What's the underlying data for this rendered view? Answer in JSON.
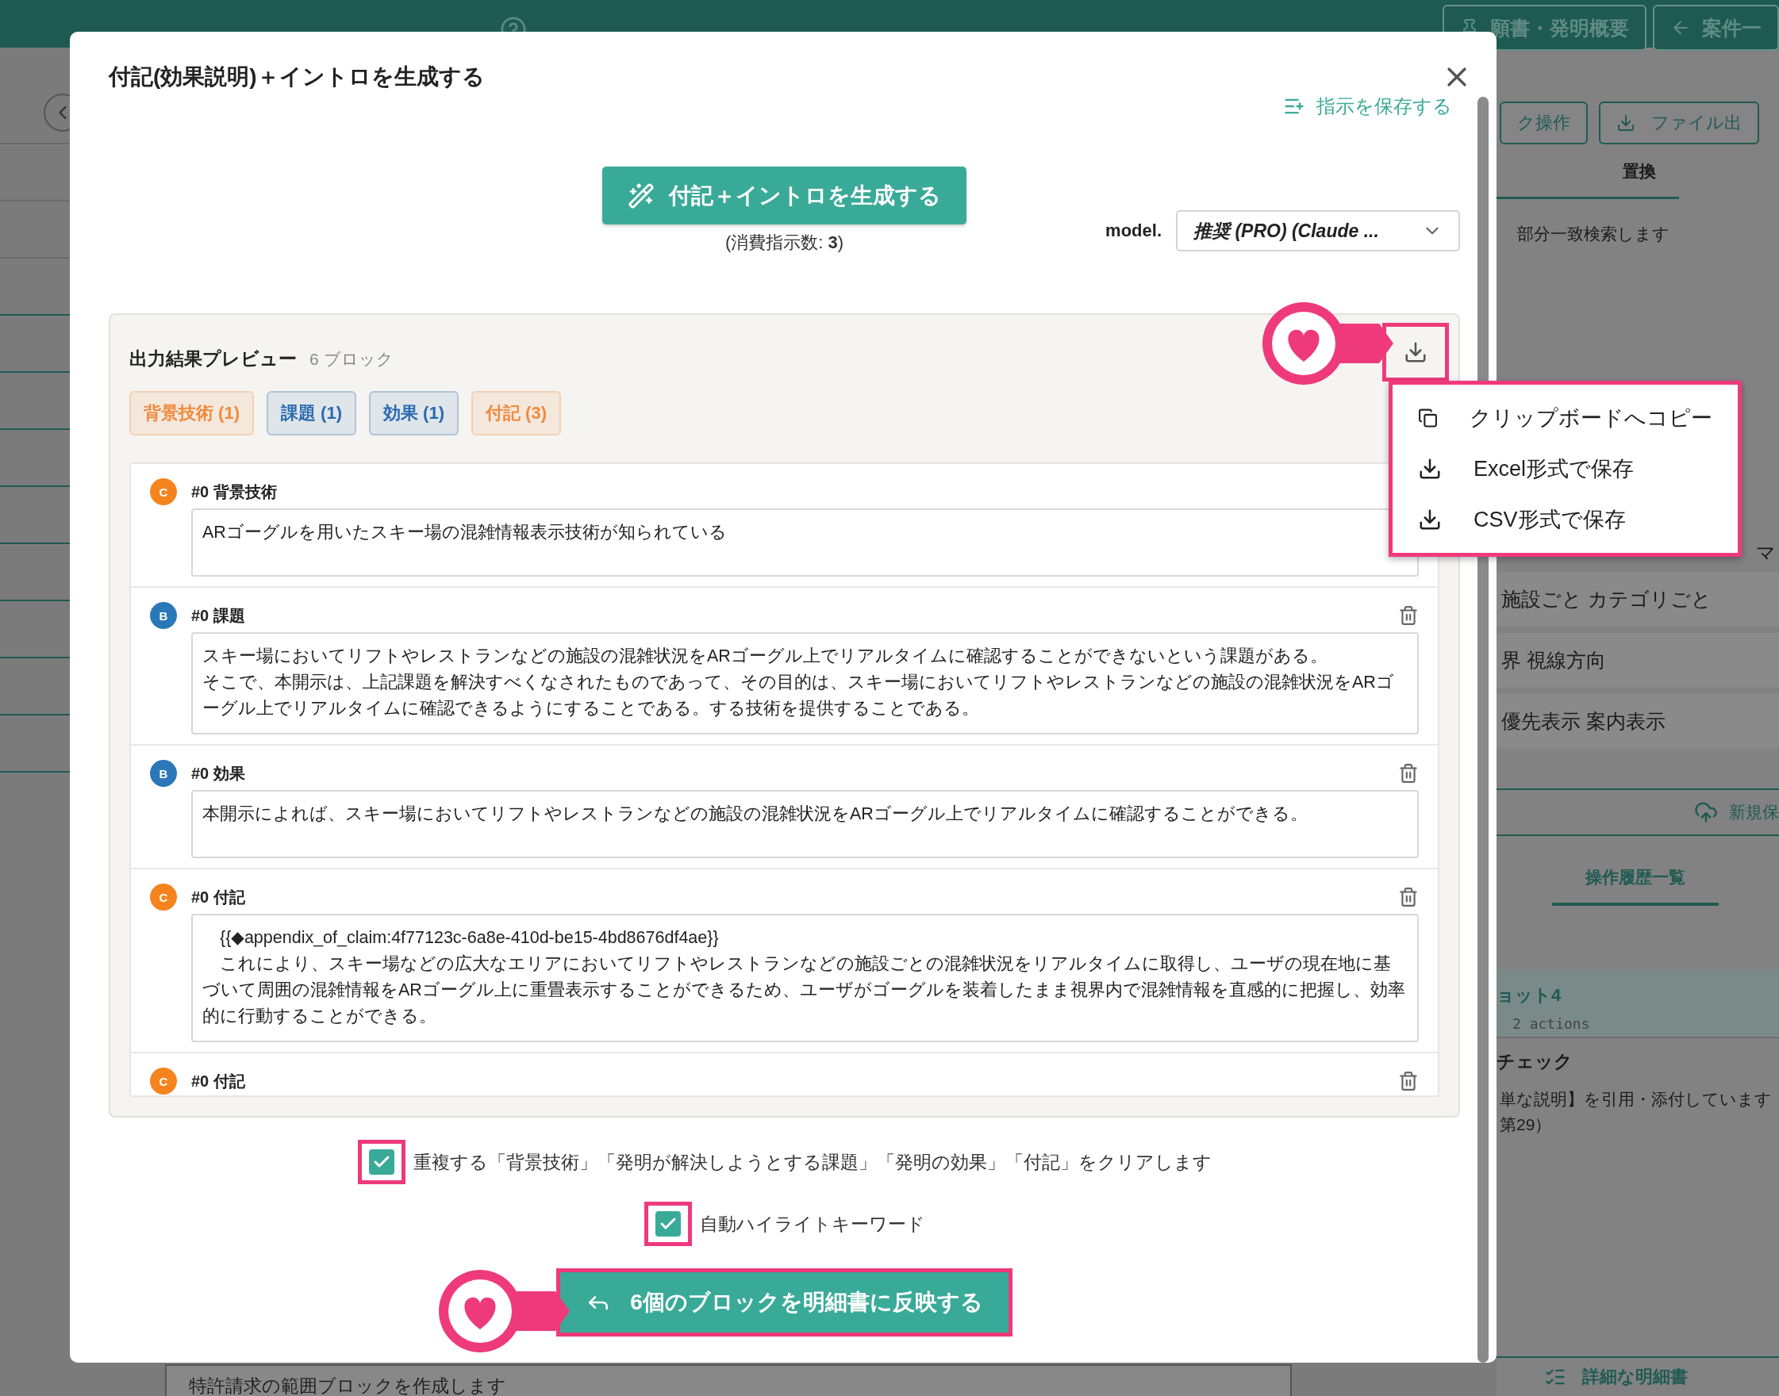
{
  "background": {
    "top_buttons": [
      "願書・発明概要",
      "案件一"
    ],
    "toolbar_buttons": [
      "ク操作",
      "ファイル出"
    ],
    "tab": "置換",
    "search_hint": "部分一致検索します",
    "edge_text": "マ",
    "keyword_rows": [
      "施設ごと カテゴリごと",
      "界 視線方向",
      "優先表示 案内表示"
    ],
    "save_button": "新規保",
    "history_tab": "操作履歴一覧",
    "history": {
      "title": "ョット4",
      "meta": "2 actions",
      "check_title": "チェック",
      "check_lines": [
        "単な説明】を引用・添付しています",
        "第29）"
      ]
    },
    "footer_link": "詳細な明細書",
    "bottom_note": "特許請求の範囲ブロックを作成します"
  },
  "dialog": {
    "title": "付記(効果説明)＋イントロを生成する",
    "save_instruction_link": "指示を保存する",
    "generate_button": "付記＋イントロを生成する",
    "cost_note": "(消費指示数: **3**)",
    "model_label": "model.",
    "model_select": "推奨 (PRO) (Claude ...",
    "preview": {
      "title": "出力結果プレビュー",
      "count": "6 ブロック",
      "tags": [
        {
          "label": "背景技術 (1)",
          "color": "#f08a3c"
        },
        {
          "label": "課題 (1)",
          "color": "#2a6bb0"
        },
        {
          "label": "効果 (1)",
          "color": "#2a6bb0"
        },
        {
          "label": "付記 (3)",
          "color": "#f08a3c"
        }
      ],
      "blocks": [
        {
          "badge": "C",
          "color": "#f5841f",
          "title": "#0 背景技術",
          "paragraphs": [
            "ARゴーグルを用いたスキー場の混雑情報表示技術が知られている"
          ]
        },
        {
          "badge": "B",
          "color": "#2a78b8",
          "title": "#0 課題",
          "paragraphs": [
            "スキー場においてリフトやレストランなどの施設の混雑状況をARゴーグル上でリアルタイムに確認することができないという課題がある。",
            "そこで、本開示は、上記課題を解決すべくなされたものであって、その目的は、スキー場においてリフトやレストランなどの施設の混雑状況をARゴーグル上でリアルタイムに確認できるようにすることである。する技術を提供することである。"
          ]
        },
        {
          "badge": "B",
          "color": "#2a78b8",
          "title": "#0 効果",
          "paragraphs": [
            "本開示によれば、スキー場においてリフトやレストランなどの施設の混雑状況をARゴーグル上でリアルタイムに確認することができる。"
          ]
        },
        {
          "badge": "C",
          "color": "#f5841f",
          "title": "#0 付記",
          "paragraphs": [
            "　{{◆appendix_of_claim:4f77123c-6a8e-410d-be15-4bd8676df4ae}}",
            "　これにより、スキー場などの広大なエリアにおいてリフトやレストランなどの施設ごとの混雑状況をリアルタイムに取得し、ユーザの現在地に基づいて周囲の混雑情報をARゴーグル上に重畳表示することができるため、ユーザがゴーグルを装着したまま視界内で混雑情報を直感的に把握し、効率的に行動することができる。"
          ]
        },
        {
          "badge": "C",
          "color": "#f5841f",
          "title": "#0 付記"
        }
      ]
    },
    "export_menu": [
      {
        "label": "クリップボードへコピー",
        "kind": "copy"
      },
      {
        "label": "Excel形式で保存",
        "kind": "download"
      },
      {
        "label": "CSV形式で保存",
        "kind": "download"
      }
    ],
    "checkboxes": [
      {
        "label": "重複する「背景技術」「発明が解決しようとする課題」「発明の効果」「付記」をクリアします",
        "checked": true
      },
      {
        "label": "自動ハイライトキーワード",
        "checked": true
      }
    ],
    "apply_button": "6個のブロックを明細書に反映する"
  }
}
